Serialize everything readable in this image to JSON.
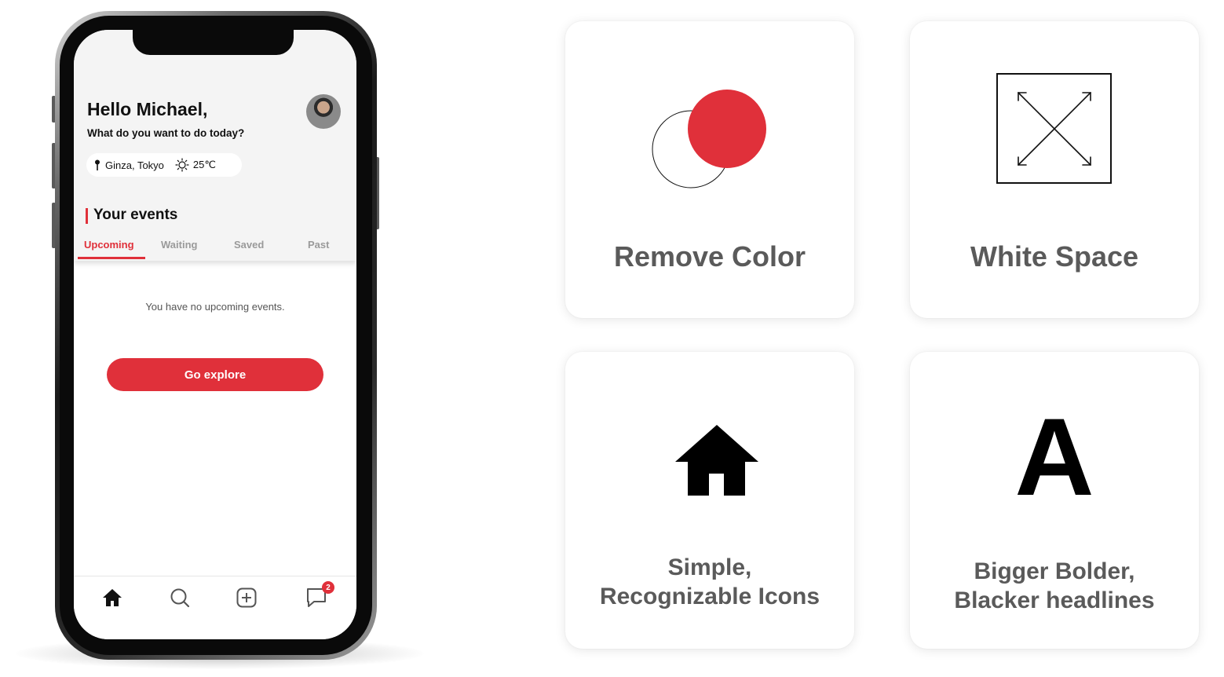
{
  "phone": {
    "greeting": "Hello Michael,",
    "subgreeting": "What do you want to do today?",
    "location": "Ginza, Tokyo",
    "temperature": "25℃",
    "events_title": "Your events",
    "tabs": [
      {
        "label": "Upcoming",
        "active": true
      },
      {
        "label": "Waiting",
        "active": false
      },
      {
        "label": "Saved",
        "active": false
      },
      {
        "label": "Past",
        "active": false
      }
    ],
    "empty_message": "You have no upcoming events.",
    "explore_button": "Go explore",
    "nav": [
      "home-icon",
      "search-icon",
      "add-icon",
      "chat-icon"
    ],
    "chat_badge": "2"
  },
  "cards": {
    "remove_color": {
      "title": "Remove Color"
    },
    "white_space": {
      "title": "White Space"
    },
    "icons": {
      "title_line1": "Simple,",
      "title_line2": "Recognizable Icons"
    },
    "headlines": {
      "glyph": "A",
      "title_line1": "Bigger Bolder,",
      "title_line2": "Blacker headlines"
    }
  },
  "colors": {
    "accent": "#e0303a",
    "text": "#111111",
    "muted": "#5a5a5a"
  }
}
